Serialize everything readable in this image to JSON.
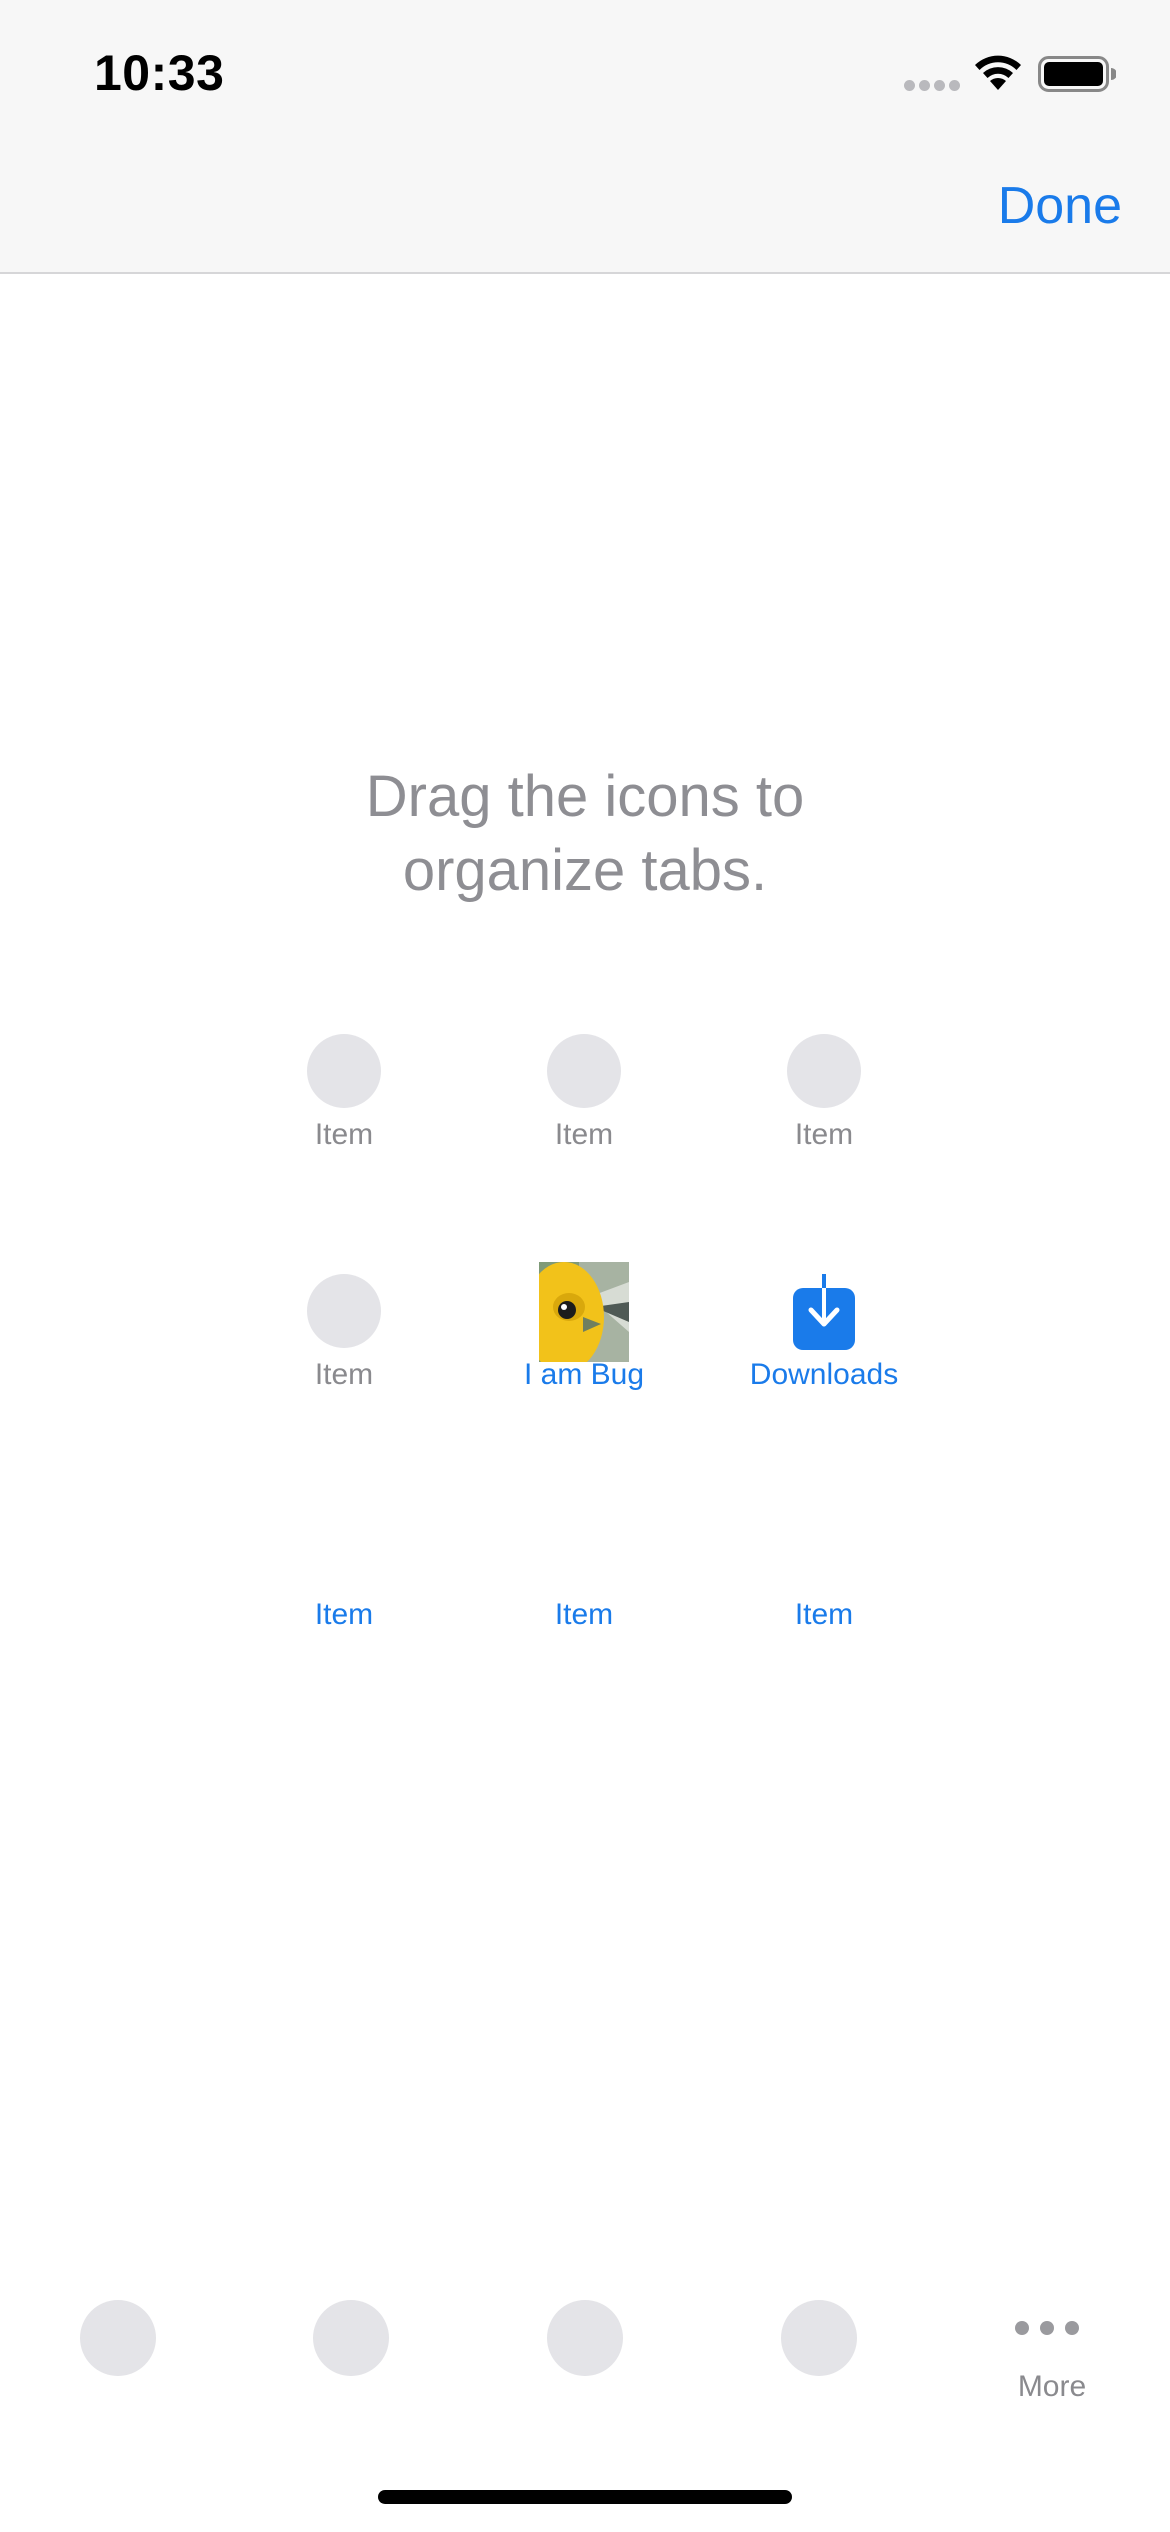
{
  "status_bar": {
    "time": "10:33"
  },
  "nav": {
    "done_label": "Done"
  },
  "instruction": {
    "line1": "Drag the icons to",
    "line2": "organize tabs."
  },
  "grid": {
    "items": [
      {
        "label": "Item",
        "active": false,
        "icon": "placeholder-circle"
      },
      {
        "label": "Item",
        "active": false,
        "icon": "placeholder-circle"
      },
      {
        "label": "Item",
        "active": false,
        "icon": "placeholder-circle"
      },
      {
        "label": "Item",
        "active": false,
        "icon": "placeholder-circle"
      },
      {
        "label": "I am Bug",
        "active": true,
        "icon": "bug-thumbnail"
      },
      {
        "label": "Downloads",
        "active": true,
        "icon": "download-icon"
      },
      {
        "label": "Item",
        "active": true,
        "icon": "none"
      },
      {
        "label": "Item",
        "active": true,
        "icon": "none"
      },
      {
        "label": "Item",
        "active": true,
        "icon": "none"
      }
    ]
  },
  "tab_bar": {
    "slots": [
      "placeholder-circle",
      "placeholder-circle",
      "placeholder-circle",
      "placeholder-circle"
    ],
    "more_label": "More",
    "more_icon": "ellipsis-icon"
  },
  "colors": {
    "accent": "#1a7bea",
    "placeholder": "#e4e4e8",
    "secondary_text": "#8e8e93",
    "header_background": "#f7f7f7"
  }
}
